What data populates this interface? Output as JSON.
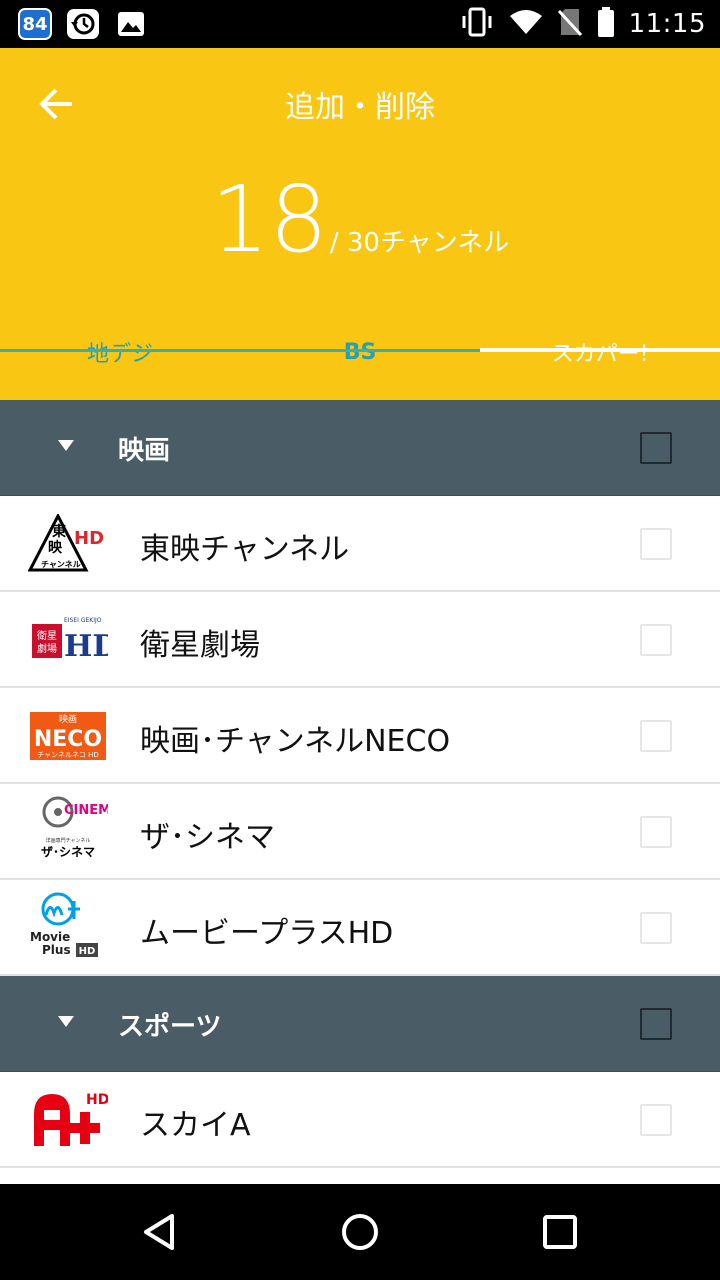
{
  "status_bar": {
    "badge": "84",
    "time": "11:15",
    "icons": [
      "restore-icon",
      "image-icon",
      "vibrate-icon",
      "wifi-icon",
      "no-sim-icon",
      "battery-icon"
    ]
  },
  "header": {
    "title": "追加・削除",
    "count": "18",
    "count_total": "/ 30チャンネル",
    "bg_color": "#f8c613"
  },
  "tabs": [
    {
      "label": "地デジ"
    },
    {
      "label": "BS"
    },
    {
      "label": "スカパー!"
    }
  ],
  "categories": [
    {
      "label": "映画",
      "channels": [
        {
          "label": "東映チャンネル"
        },
        {
          "label": "衛星劇場"
        },
        {
          "label": "映画･チャンネルNECO"
        },
        {
          "label": "ザ･シネマ"
        },
        {
          "label": "ムービープラスHD"
        }
      ]
    },
    {
      "label": "スポーツ",
      "channels": [
        {
          "label": "スカイA"
        }
      ]
    }
  ],
  "logos": {
    "toei": {
      "line1": "東",
      "line2": "映",
      "hd": "HD",
      "sub": "チャンネル"
    },
    "eisei": {
      "box": "衛星劇場",
      "hd": "HD",
      "top": "EISEI GEKIJO"
    },
    "neco": {
      "top": "映画",
      "main": "NECO",
      "sub": "チャンネルネコ HD"
    },
    "cinema": {
      "main": "CINEMA",
      "sub1": "洋画専門チャンネル",
      "sub2": "ザ･シネマ"
    },
    "movieplus": {
      "line1": "Movie",
      "line2": "Plus",
      "hd": "HD"
    },
    "skya": {
      "main": "A+",
      "hd": "HD"
    }
  }
}
